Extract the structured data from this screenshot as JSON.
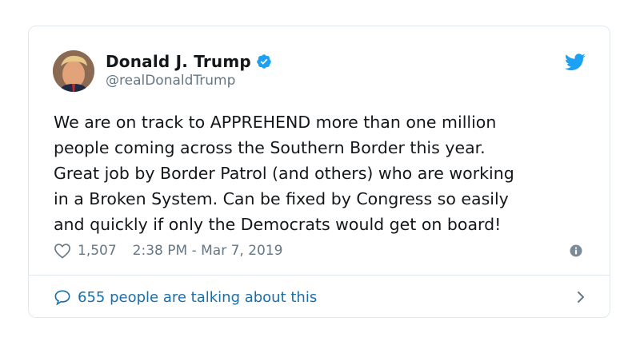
{
  "tweet": {
    "author_name": "Donald J. Trump",
    "handle": "@realDonaldTrump",
    "text": "We are on track to APPREHEND more than one million\npeople coming across the Southern Border this year.\nGreat job by Border Patrol (and others) who are working\nin a Broken System. Can be fixed by Congress so easily\nand quickly if only the Democrats would get on board!",
    "likes": "1,507",
    "timestamp": "2:38 PM - Mar 7, 2019",
    "conversation_label": "655 people are talking about this"
  },
  "icons": {
    "verified": "verified-badge-icon",
    "brand": "twitter-bird-icon",
    "like": "heart-icon",
    "info": "info-icon",
    "reply": "speech-bubble-icon",
    "more": "chevron-right-icon"
  },
  "colors": {
    "twitter_blue": "#1da1f2",
    "link_blue": "#1b6ea8",
    "text": "#14171a",
    "muted": "#657786",
    "border": "#e1e8ed"
  }
}
